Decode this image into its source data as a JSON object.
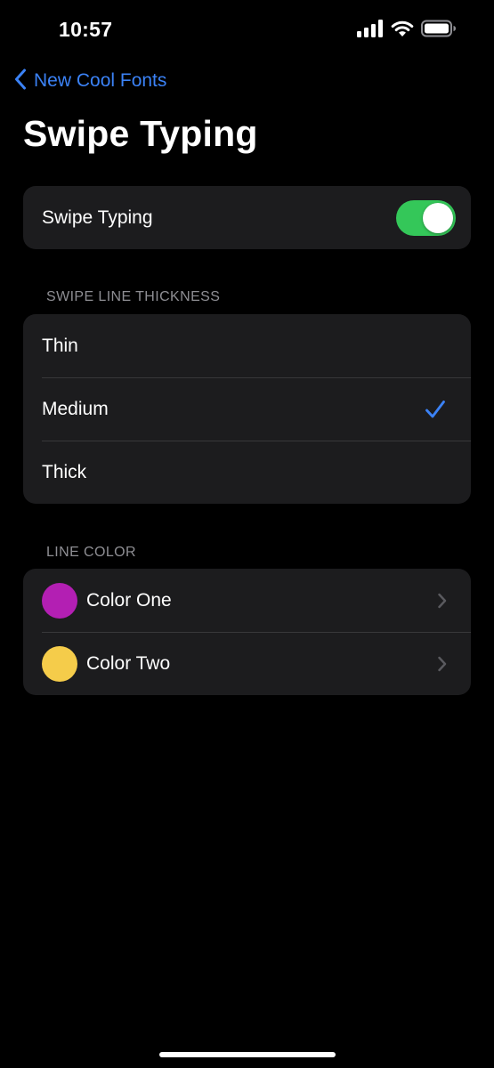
{
  "status_bar": {
    "time": "10:57",
    "icons": [
      "cellular-signal-icon",
      "wifi-icon",
      "battery-icon"
    ]
  },
  "nav": {
    "back_label": "New Cool Fonts",
    "back_icon": "chevron-left-icon",
    "accent_color": "#3b82f6"
  },
  "page": {
    "title": "Swipe Typing"
  },
  "swipe_toggle": {
    "label": "Swipe Typing",
    "enabled": true,
    "on_color": "#34c759"
  },
  "thickness": {
    "header": "SWIPE LINE THICKNESS",
    "options": [
      {
        "label": "Thin",
        "selected": false
      },
      {
        "label": "Medium",
        "selected": true
      },
      {
        "label": "Thick",
        "selected": false
      }
    ]
  },
  "line_color": {
    "header": "LINE COLOR",
    "items": [
      {
        "label": "Color One",
        "swatch": "#b31fb3"
      },
      {
        "label": "Color Two",
        "swatch": "#f5cc4a"
      }
    ]
  }
}
